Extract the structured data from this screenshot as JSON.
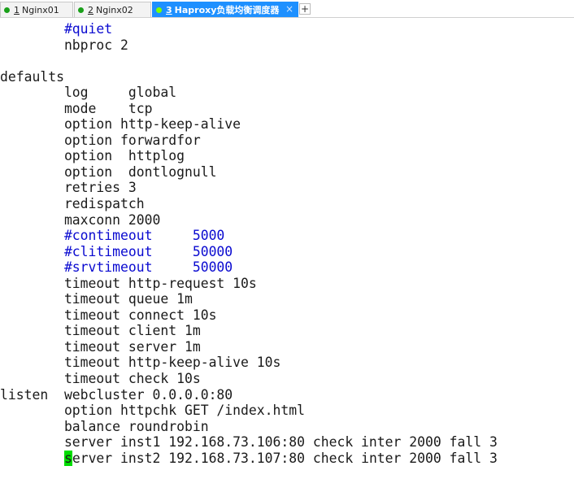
{
  "tabs": [
    {
      "num": "1",
      "label": "Nginx01",
      "dot_color": "#1aa01a",
      "active": false
    },
    {
      "num": "2",
      "label": "Nginx02",
      "dot_color": "#1aa01a",
      "active": false
    },
    {
      "num": "3",
      "label": "Haproxy负载均衡调度器",
      "dot_color": "#7fff00",
      "active": true
    }
  ],
  "tab_close": "×",
  "tab_add": "+",
  "terminal": {
    "lines": [
      {
        "text": "        #quiet",
        "comment": true
      },
      {
        "text": "        nbproc 2",
        "comment": false
      },
      {
        "text": "",
        "comment": false
      },
      {
        "text": "defaults",
        "comment": false
      },
      {
        "text": "        log     global",
        "comment": false
      },
      {
        "text": "        mode    tcp",
        "comment": false
      },
      {
        "text": "        option http-keep-alive",
        "comment": false
      },
      {
        "text": "        option forwardfor",
        "comment": false
      },
      {
        "text": "        option  httplog",
        "comment": false
      },
      {
        "text": "        option  dontlognull",
        "comment": false
      },
      {
        "text": "        retries 3",
        "comment": false
      },
      {
        "text": "        redispatch",
        "comment": false
      },
      {
        "text": "        maxconn 2000",
        "comment": false
      },
      {
        "text": "        #contimeout     5000",
        "comment": true
      },
      {
        "text": "        #clitimeout     50000",
        "comment": true
      },
      {
        "text": "        #srvtimeout     50000",
        "comment": true
      },
      {
        "text": "        timeout http-request 10s",
        "comment": false
      },
      {
        "text": "        timeout queue 1m",
        "comment": false
      },
      {
        "text": "        timeout connect 10s",
        "comment": false
      },
      {
        "text": "        timeout client 1m",
        "comment": false
      },
      {
        "text": "        timeout server 1m",
        "comment": false
      },
      {
        "text": "        timeout http-keep-alive 10s",
        "comment": false
      },
      {
        "text": "        timeout check 10s",
        "comment": false
      },
      {
        "text": "listen  webcluster 0.0.0.0:80",
        "comment": false
      },
      {
        "text": "        option httpchk GET /index.html",
        "comment": false
      },
      {
        "text": "        balance roundrobin",
        "comment": false
      },
      {
        "text": "        server inst1 192.168.73.106:80 check inter 2000 fall 3",
        "comment": false
      }
    ],
    "cursor_line": {
      "indent": "        ",
      "cursor_char": "s",
      "rest": "erver inst2 192.168.73.107:80 check inter 2000 fall 3"
    }
  }
}
